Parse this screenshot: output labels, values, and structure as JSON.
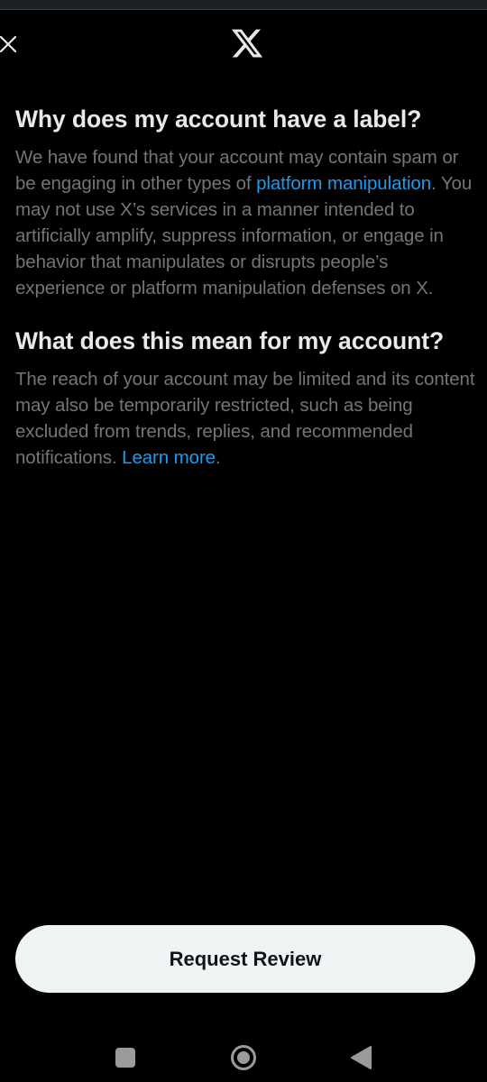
{
  "header": {
    "close_icon": "close-icon",
    "logo_icon": "x-logo-icon"
  },
  "section1": {
    "title": "Why does my account have a label?",
    "text_before_link": "We have found that your account may contain spam or be engaging in other types of ",
    "link": "platform manipulation",
    "text_after_link": ". You may not use X’s services in a manner intended to artificially amplify, suppress information, or engage in behavior that manipulates or disrupts people’s experience or platform manipulation defenses on X."
  },
  "section2": {
    "title": "What does this mean for my account?",
    "text_before_link": "The reach of your account may be limited and its content may also be temporarily restricted, such as being excluded from trends, replies, and recommended notifications. ",
    "link": "Learn more",
    "text_after_link": "."
  },
  "action": {
    "button_label": "Request Review"
  },
  "navbar": {
    "recents_icon": "square-recents-icon",
    "home_icon": "circle-home-icon",
    "back_icon": "triangle-back-icon"
  },
  "colors": {
    "background": "#000000",
    "heading": "#e7e9ea",
    "body_text": "#71767b",
    "link": "#1d9bf0",
    "button_bg": "#eff3f4",
    "button_text": "#0f1419"
  }
}
